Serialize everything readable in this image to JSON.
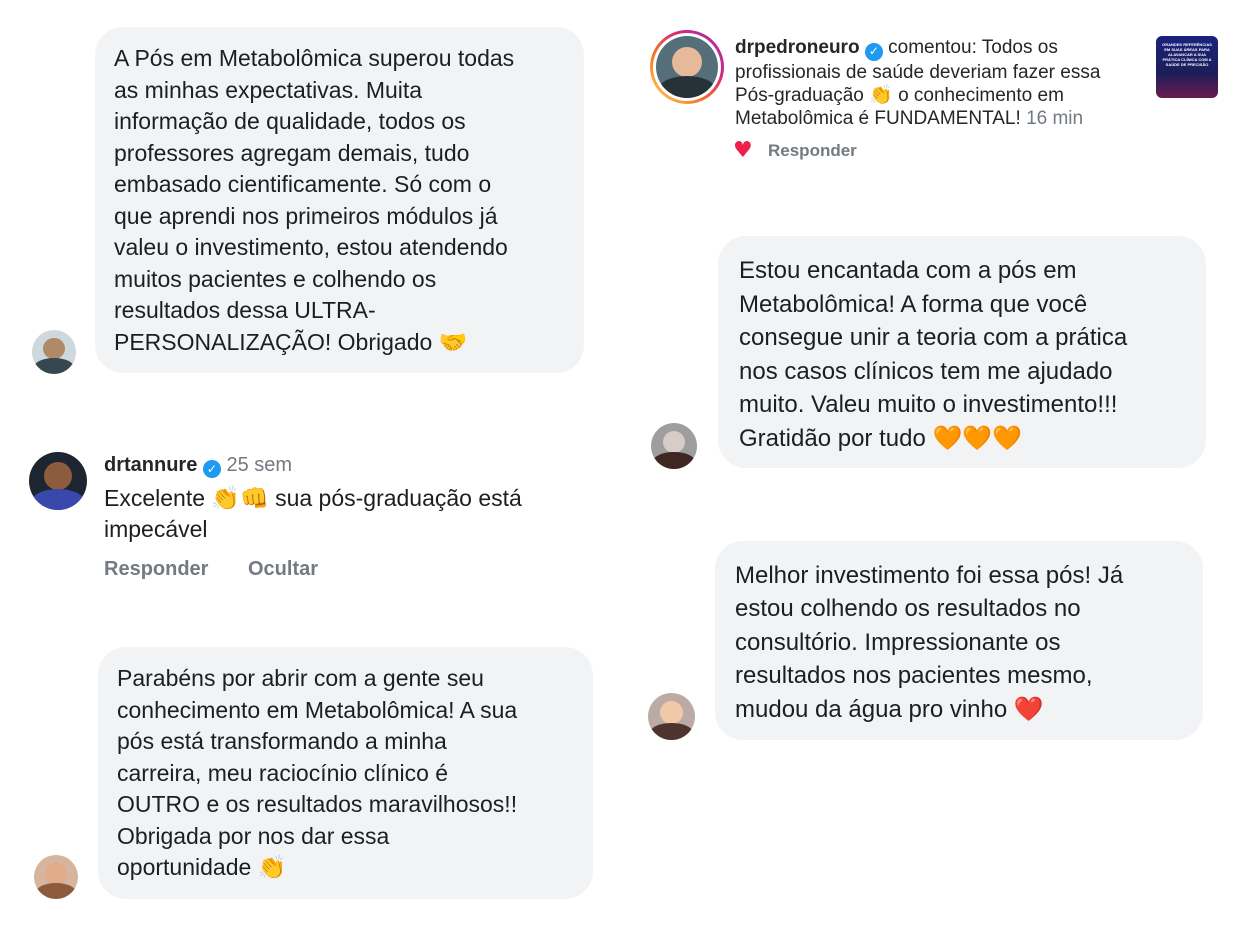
{
  "testimonials": {
    "t1_text": "A Pós em Metabolômica superou todas\nas minhas expectativas. Muita\ninformação de qualidade, todos os\nprofessores agregam demais, tudo\nembasado cientificamente. Só com o\nque aprendi nos primeiros módulos já\nvaleu o investimento, estou atendendo\nmuitos pacientes e colhendo os\nresultados dessa ULTRA-\nPERSONALIZAÇÃO! Obrigado 🤝",
    "t3_text": "Parabéns por abrir com a gente seu\nconhecimento em Metabolômica! A sua\npós está transformando a minha\ncarreira, meu raciocínio clínico é\nOUTRO e os resultados maravilhosos!!\nObrigada por nos dar essa\noportunidade 👏",
    "t4_text": "Estou encantada com a pós em\nMetabolômica! A forma que você\nconsegue unir a teoria com a prática\nnos casos clínicos tem me ajudado\nmuito. Valeu muito o investimento!!!\nGratidão por tudo 🧡🧡🧡",
    "t5_text": "Melhor investimento foi essa pós! Já\nestou colhendo os resultados no\nconsultório. Impressionante os\nresultados nos pacientes mesmo,\nmudou da água pro vinho ❤️"
  },
  "comment_drtannure": {
    "username": "drtannure",
    "verified_mark": "✓",
    "time": "25 sem",
    "text": "Excelente 👏👊 sua pós-graduação está\nimpecável",
    "reply_label": "Responder",
    "hide_label": "Ocultar"
  },
  "notification_drpedroneuro": {
    "username": "drpedroneuro",
    "verified_mark": "✓",
    "action": "comentou:",
    "text": "Todos os\nprofissionais de saúde deveriam fazer essa\nPós-graduação 👏 o conhecimento em\nMetabolômica é FUNDAMENTAL!",
    "time": "16 min",
    "like_icon": "♥",
    "reply_label": "Responder",
    "post_thumbnail_text": "GRANDES REFERÊNCIAS EM SUAS ÁREAS PARA ALAVANCAR A SUA PRÁTICA CLÍNICA COM A SAÚDE DE PRECISÃO"
  },
  "colors": {
    "bubble": "#f2f3f5",
    "verified": "#1d9bf0",
    "like": "#ed2048",
    "muted": "#737a82",
    "story_ring": "#e1306c"
  }
}
